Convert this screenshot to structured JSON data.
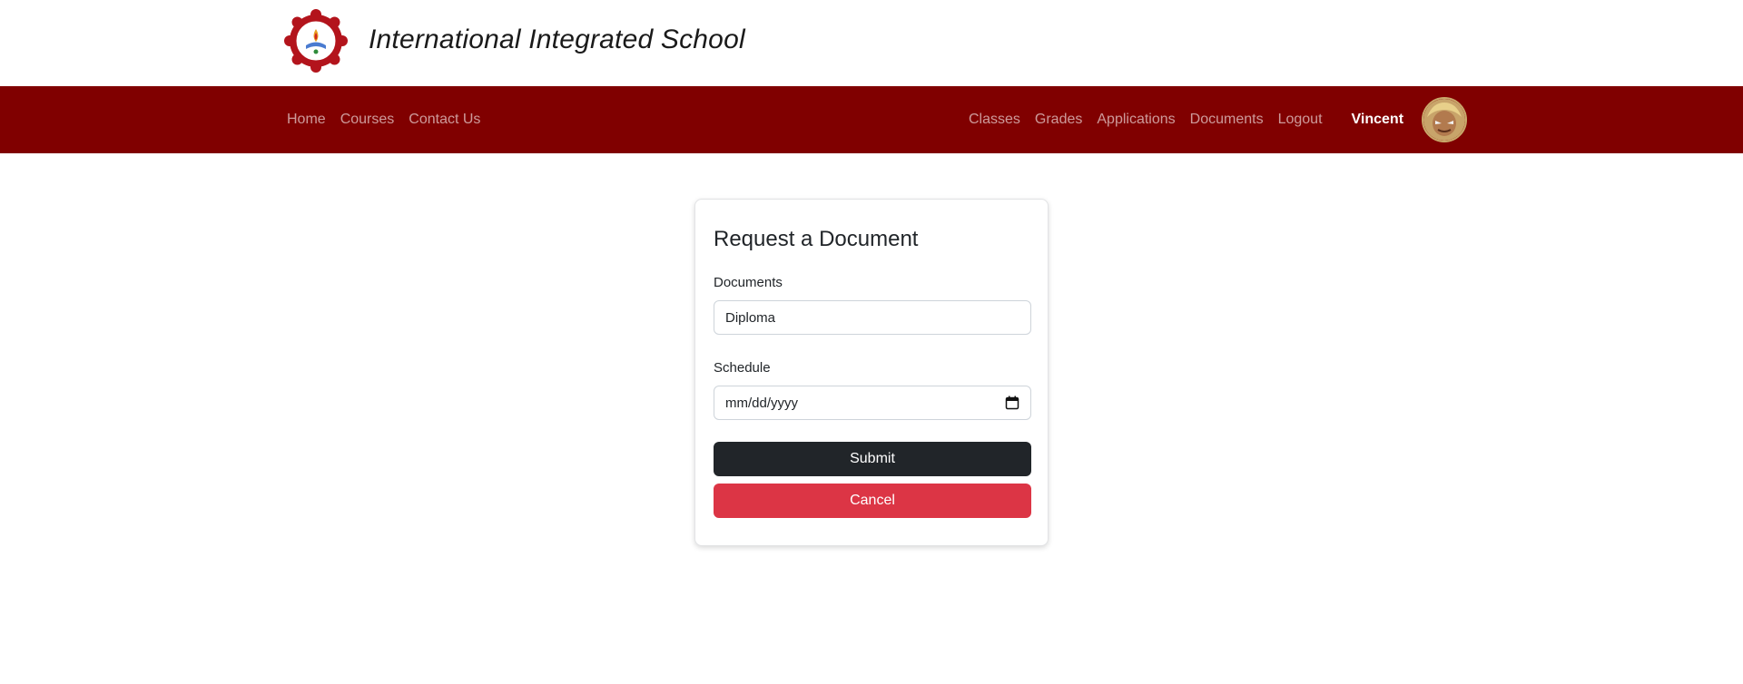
{
  "header": {
    "school_name": "International Integrated School",
    "logo_icon": "school-seal-logo"
  },
  "navbar": {
    "left_links": [
      "Home",
      "Courses",
      "Contact Us"
    ],
    "right_links": [
      "Classes",
      "Grades",
      "Applications",
      "Documents",
      "Logout"
    ],
    "user_name": "Vincent",
    "avatar_icon": "user-avatar",
    "background_color": "#800000"
  },
  "form": {
    "title": "Request a Document",
    "documents_label": "Documents",
    "documents_value": "Diploma",
    "schedule_label": "Schedule",
    "schedule_value": "mm/dd/yyyy",
    "calendar_icon": "calendar-icon",
    "submit_label": "Submit",
    "cancel_label": "Cancel",
    "submit_color": "#212529",
    "cancel_color": "#dc3545"
  }
}
